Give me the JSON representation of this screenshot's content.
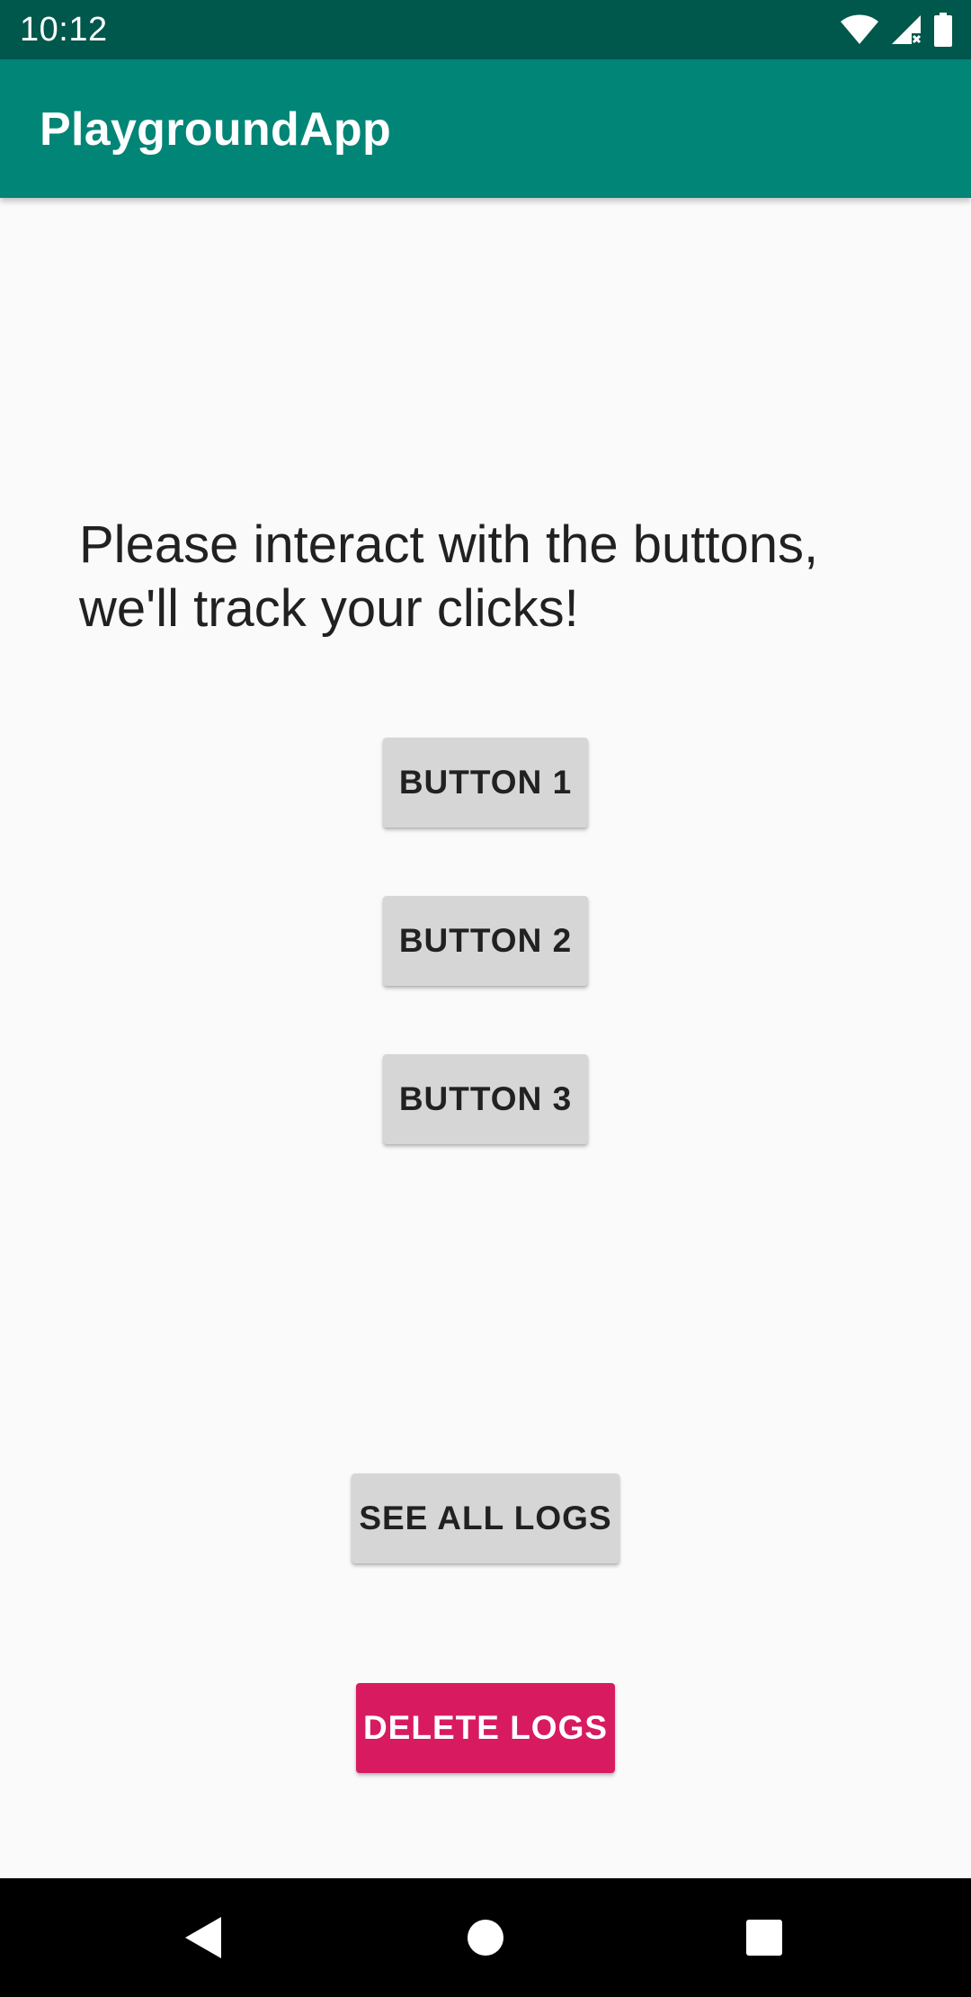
{
  "status_bar": {
    "time": "10:12",
    "icons": [
      "wifi-icon",
      "cell-signal-icon",
      "battery-icon"
    ]
  },
  "app_bar": {
    "title": "PlaygroundApp",
    "color": "#008577",
    "status_color": "#00574b"
  },
  "main": {
    "instructions": "Please interact with the buttons, we'll track your clicks!",
    "buttons": [
      {
        "label": "BUTTON 1"
      },
      {
        "label": "BUTTON 2"
      },
      {
        "label": "BUTTON 3"
      }
    ],
    "see_all_logs_label": "SEE ALL LOGS",
    "delete_logs_label": "DELETE LOGS",
    "accent_color": "#d81b60"
  },
  "nav_bar": {
    "icons": [
      "back-icon",
      "home-icon",
      "recents-icon"
    ]
  }
}
